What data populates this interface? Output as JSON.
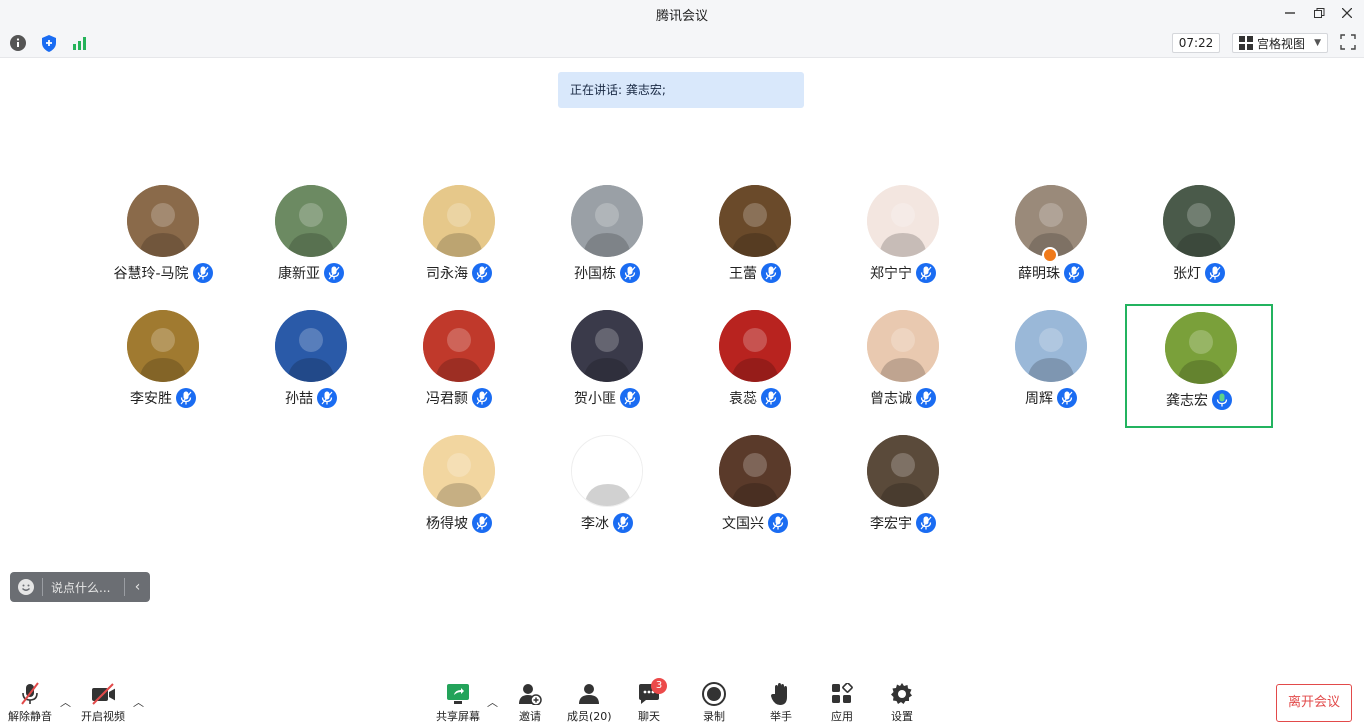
{
  "window": {
    "title": "腾讯会议"
  },
  "topbar": {
    "timer": "07:22",
    "view_label": "宫格视图"
  },
  "speaking": {
    "text": "正在讲话: 龚志宏;"
  },
  "participants": [
    {
      "name": "谷慧玲-马院",
      "color": "#8a6a4a"
    },
    {
      "name": "康新亚",
      "color": "#6c8a62"
    },
    {
      "name": "司永海",
      "color": "#e6c88a"
    },
    {
      "name": "孙国栋",
      "color": "#9aa0a6"
    },
    {
      "name": "王蕾",
      "color": "#6a4a2a"
    },
    {
      "name": "郑宁宁",
      "color": "#f3e6e0"
    },
    {
      "name": "薛明珠",
      "color": "#9a8a7a"
    },
    {
      "name": "张灯",
      "color": "#4a5a4a"
    },
    {
      "name": "李安胜",
      "color": "#a07a30"
    },
    {
      "name": "孙喆",
      "color": "#2a5aa8"
    },
    {
      "name": "冯君颢",
      "color": "#c0392b"
    },
    {
      "name": "贺小匪",
      "color": "#3a3a4a"
    },
    {
      "name": "袁蕊",
      "color": "#b8231f"
    },
    {
      "name": "曾志诚",
      "color": "#e9c9b0"
    },
    {
      "name": "周辉",
      "color": "#9ab8d8"
    },
    {
      "name": "龚志宏",
      "color": "#7aa03a"
    },
    {
      "name": "杨得坡",
      "color": "#f2d6a0"
    },
    {
      "name": "李冰",
      "color": "#ffffff"
    },
    {
      "name": "文国兴",
      "color": "#5a3a2a"
    },
    {
      "name": "李宏宇",
      "color": "#5a4a3a"
    }
  ],
  "chat_input": {
    "placeholder": "说点什么..."
  },
  "bottom": {
    "unmute": "解除静音",
    "video": "开启视频",
    "share": "共享屏幕",
    "invite": "邀请",
    "members": "成员(20)",
    "chat": "聊天",
    "chat_badge": "3",
    "record": "录制",
    "raise_hand": "举手",
    "apps": "应用",
    "settings": "设置",
    "leave": "离开会议"
  },
  "colors": {
    "accent": "#1a6cf2",
    "active_border": "#23b35f",
    "leave": "#e24a4a",
    "speaking_bg": "#d9e8fb"
  }
}
